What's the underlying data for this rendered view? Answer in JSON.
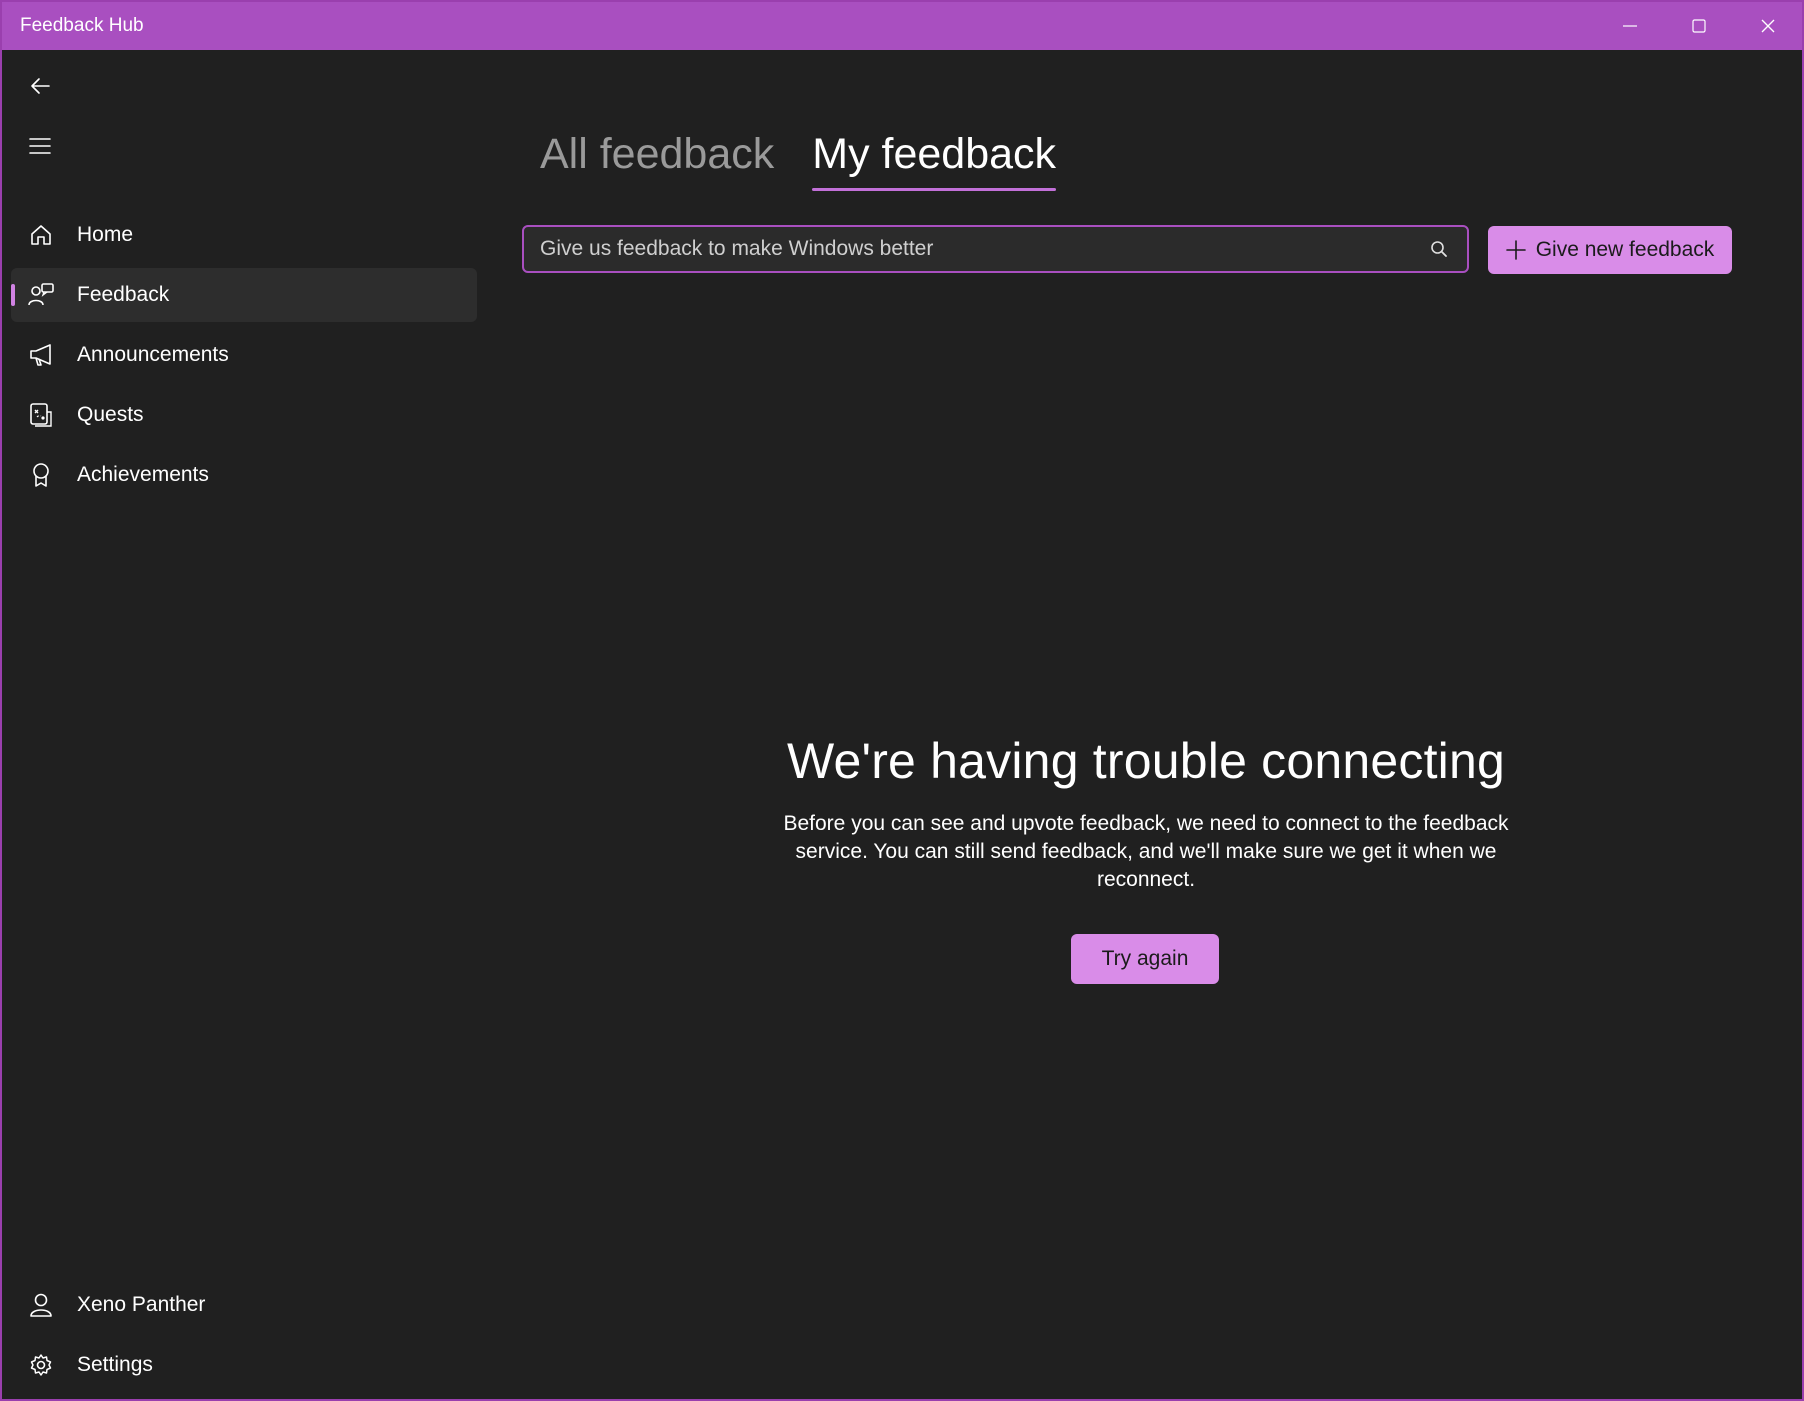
{
  "window": {
    "title": "Feedback Hub",
    "accent": "#a94fc0"
  },
  "sidebar": {
    "items": [
      {
        "label": "Home",
        "icon": "home-icon"
      },
      {
        "label": "Feedback",
        "icon": "feedback-icon",
        "selected": true
      },
      {
        "label": "Announcements",
        "icon": "megaphone-icon"
      },
      {
        "label": "Quests",
        "icon": "quest-icon"
      },
      {
        "label": "Achievements",
        "icon": "award-icon"
      }
    ],
    "footer": [
      {
        "label": "Xeno Panther",
        "icon": "user-icon"
      },
      {
        "label": "Settings",
        "icon": "gear-icon"
      }
    ]
  },
  "tabs": [
    {
      "label": "All feedback",
      "active": false
    },
    {
      "label": "My feedback",
      "active": true
    }
  ],
  "search": {
    "placeholder": "Give us feedback to make Windows better"
  },
  "actions": {
    "new_feedback": "Give new feedback"
  },
  "message": {
    "heading": "We're having trouble connecting",
    "body": "Before you can see and upvote feedback, we need to connect to the feedback service. You can still send feedback, and we'll make sure we get it when we reconnect.",
    "retry": "Try again"
  }
}
